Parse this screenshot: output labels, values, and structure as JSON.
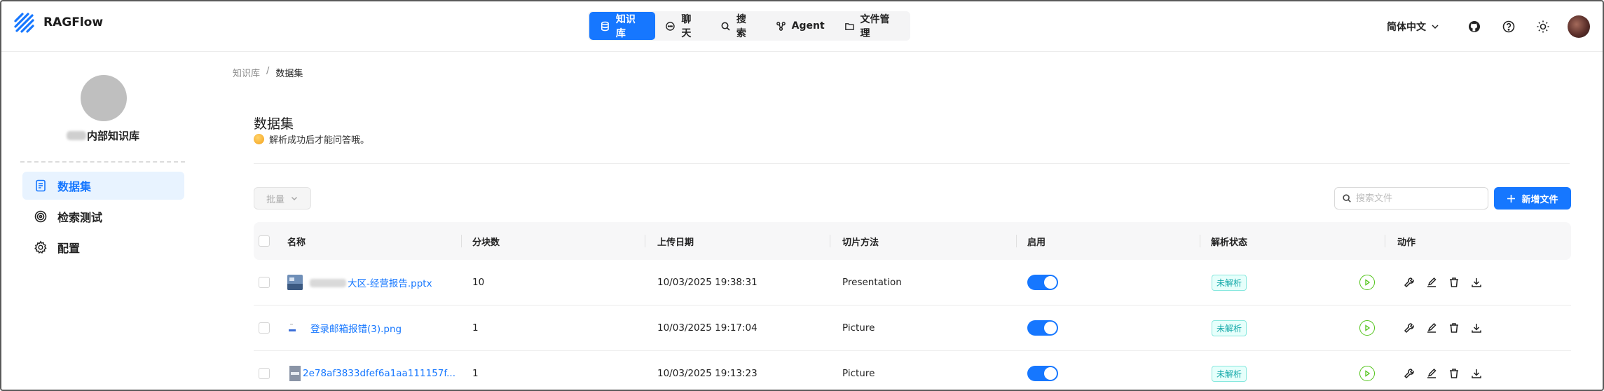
{
  "app": {
    "brand": "RAGFlow",
    "accent_color": "#1677ff"
  },
  "nav": {
    "tabs": [
      {
        "label": "知识库",
        "icon": "database-icon",
        "active": true
      },
      {
        "label": "聊天",
        "icon": "chat-icon",
        "active": false
      },
      {
        "label": "搜索",
        "icon": "search-icon",
        "active": false
      },
      {
        "label": "Agent",
        "icon": "agent-icon",
        "active": false
      },
      {
        "label": "文件管理",
        "icon": "folder-icon",
        "active": false
      }
    ]
  },
  "header_right": {
    "language": "简体中文",
    "icons": [
      "github-icon",
      "help-icon",
      "theme-sun-icon"
    ]
  },
  "sidebar": {
    "kb_name_suffix": "内部知识库",
    "items": [
      {
        "label": "数据集",
        "icon": "document-icon",
        "active": true
      },
      {
        "label": "检索测试",
        "icon": "target-icon",
        "active": false
      },
      {
        "label": "配置",
        "icon": "gear-icon",
        "active": false
      }
    ]
  },
  "breadcrumb": {
    "root": "知识库",
    "separator": "/",
    "current": "数据集"
  },
  "page": {
    "title": "数据集",
    "tip": "解析成功后才能问答哦。"
  },
  "toolbar": {
    "batch_label": "批量",
    "search_placeholder": "搜索文件",
    "add_label": "新增文件"
  },
  "table": {
    "columns": [
      "名称",
      "分块数",
      "上传日期",
      "切片方法",
      "启用",
      "解析状态",
      "动作"
    ],
    "rows": [
      {
        "name_visible": "大区-经营报告.pptx",
        "chunks": "10",
        "upload_date": "10/03/2025 19:38:31",
        "method": "Presentation",
        "enabled": true,
        "status": "未解析"
      },
      {
        "name_visible": "登录邮箱报错(3).png",
        "chunks": "1",
        "upload_date": "10/03/2025 19:17:04",
        "method": "Picture",
        "enabled": true,
        "status": "未解析"
      },
      {
        "name_visible": "2e78af3833dfef6a1aa111157f...",
        "chunks": "1",
        "upload_date": "10/03/2025 19:13:23",
        "method": "Picture",
        "enabled": true,
        "status": "未解析"
      }
    ]
  }
}
